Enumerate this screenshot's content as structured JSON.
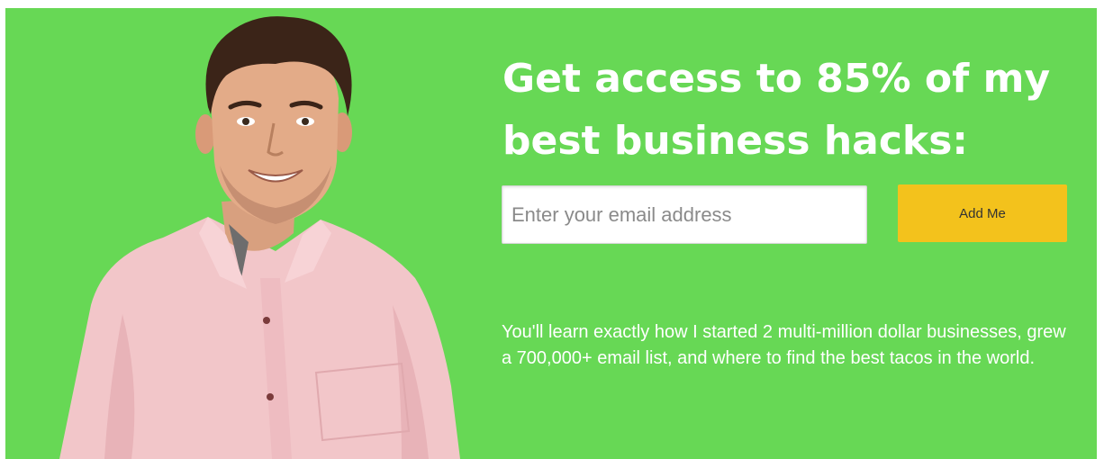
{
  "colors": {
    "background": "#67d855",
    "button": "#f3c21c",
    "text": "#ffffff"
  },
  "hero": {
    "headline": "Get access to 85% of my best business hacks:",
    "email_placeholder": "Enter your email address",
    "button_label": "Add Me",
    "description": "You'll learn exactly how I started 2 multi-million dollar businesses, grew a 700,000+ email list, and where to find the best tacos in the world."
  }
}
